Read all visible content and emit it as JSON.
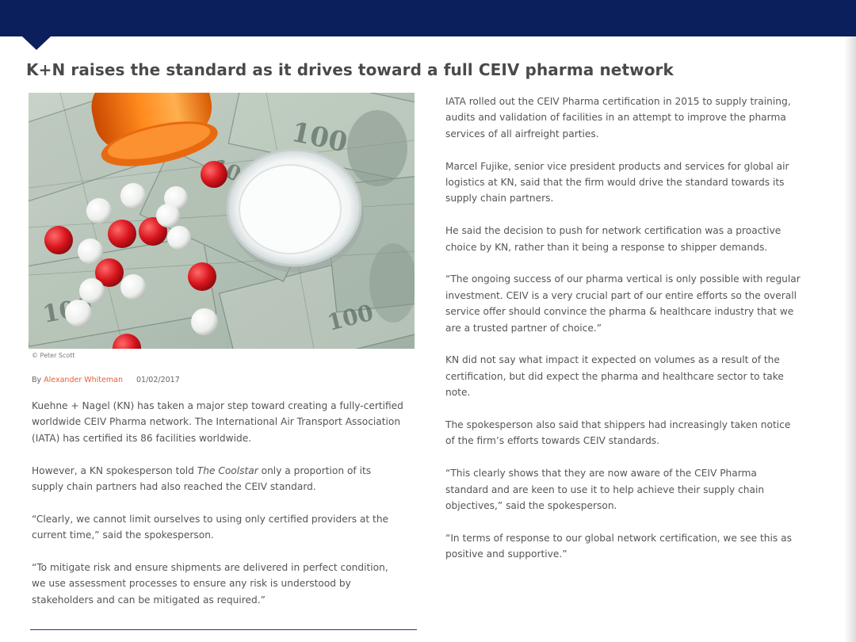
{
  "article": {
    "title": "K+N raises the standard as it drives toward a full CEIV pharma network",
    "image_caption": "© Peter Scott",
    "byline_prefix": "By",
    "author": "Alexander Whiteman",
    "date": "01/02/2017",
    "left_paragraphs": [
      "Kuehne + Nagel (KN) has taken a major step toward creating a fully-certified worldwide CEIV Pharma network. The International Air Transport Association (IATA) has certified its 86 facilities worldwide.",
      {
        "before": "However, a KN spokesperson told ",
        "em": "The Coolstar",
        "after": " only a proportion of its supply chain partners had also reached the CEIV standard."
      },
      "“Clearly, we cannot limit ourselves to using only certified providers at the current time,” said the spokesperson.",
      "“To mitigate risk and ensure shipments are delivered in perfect condition, we use assessment processes to ensure any risk is understood by stakeholders and can be mitigated as required.”"
    ],
    "right_paragraphs": [
      "IATA rolled out the CEIV Pharma certification in 2015 to supply training, audits and validation of facilities in an attempt to improve the pharma services of all airfreight parties.",
      "Marcel Fujike, senior vice president products and services for global air logistics at KN, said that the firm would drive the standard towards its supply chain partners.",
      "He said the decision to push for network certification was a proactive choice by KN, rather than it being a response to shipper demands.",
      "“The ongoing success of our pharma vertical is only possible with regular investment. CEIV is a very crucial part of our entire efforts so the overall service offer should convince the pharma & healthcare industry that we are a trusted partner of choice.”",
      "KN did not say what impact it expected on volumes as a result of the certification, but did expect the pharma and healthcare sector to take note.",
      "The spokesperson also said that shippers had increasingly taken notice of the firm’s efforts towards CEIV standards.",
      "“This clearly shows that they are now aware of the CEIV Pharma standard and are keen to use it to help achieve their supply chain objectives,” said the spokesperson.",
      "“In terms of response to our global network certification, we see this as positive and supportive.”"
    ]
  },
  "colors": {
    "header_navy": "#0a1f5c",
    "author_link": "#e0623a",
    "body_text": "#555555",
    "title_text": "#4a4a4a"
  },
  "icons": {
    "notch": "header-pointer-triangle"
  }
}
